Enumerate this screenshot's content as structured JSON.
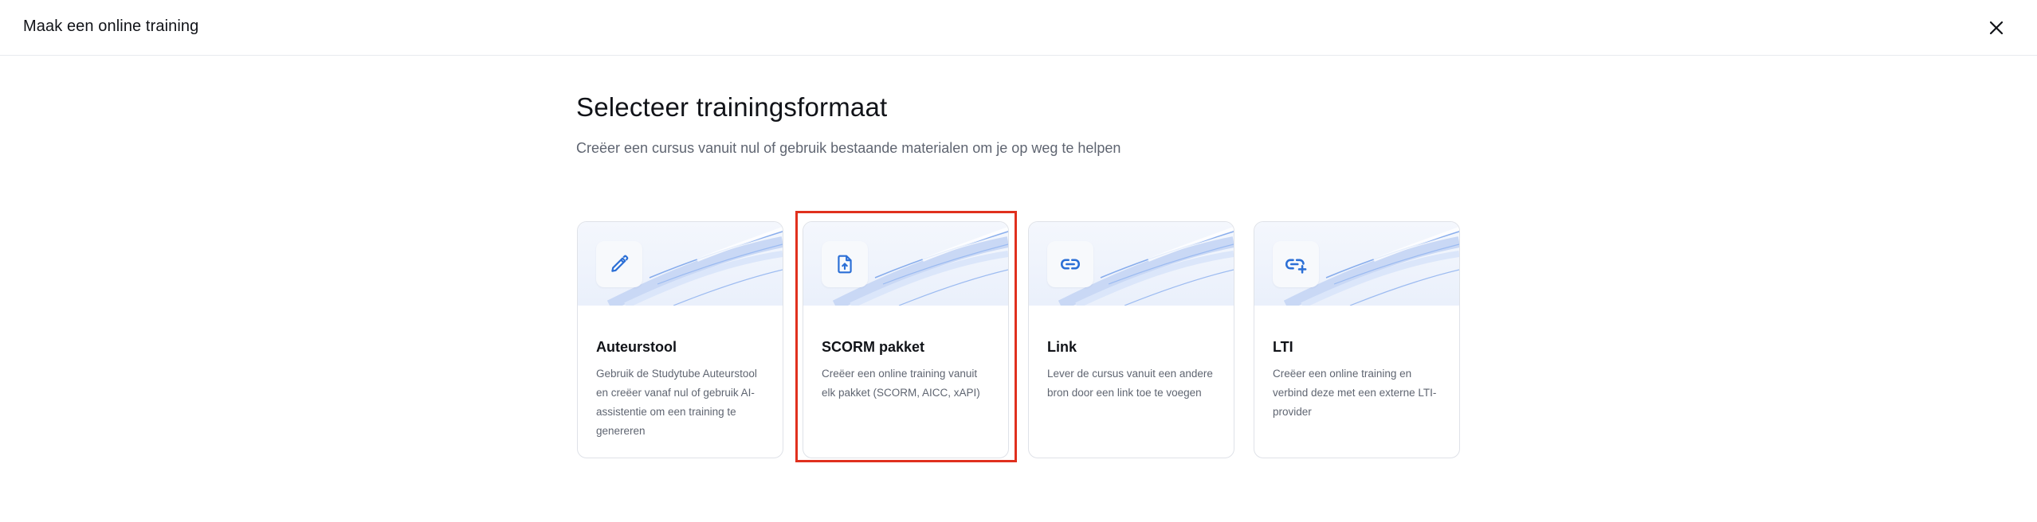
{
  "header": {
    "title": "Maak een online training",
    "close_icon": "close-icon"
  },
  "main": {
    "heading": "Selecteer trainingsformaat",
    "subheading": "Creëer een cursus vanuit nul of gebruik bestaande materialen om je op weg te helpen"
  },
  "cards": [
    {
      "title": "Auteurstool",
      "description": "Gebruik de Studytube Auteurstool en creëer vanaf nul of gebruik AI-assistentie om een training te genereren",
      "icon": "pencil-icon"
    },
    {
      "title": "SCORM pakket",
      "description": "Creëer een online training vanuit elk pakket (SCORM, AICC, xAPI)",
      "icon": "file-upload-icon",
      "highlighted": true
    },
    {
      "title": "Link",
      "description": "Lever de cursus vanuit een andere bron door een link toe te voegen",
      "icon": "link-icon"
    },
    {
      "title": "LTI",
      "description": "Creëer een online training en verbind deze met een externe LTI-provider",
      "icon": "link-plus-icon"
    }
  ],
  "colors": {
    "accent": "#2b6fd6",
    "highlight": "#e0301e",
    "text_primary": "#111318",
    "text_secondary": "#5f6571"
  }
}
